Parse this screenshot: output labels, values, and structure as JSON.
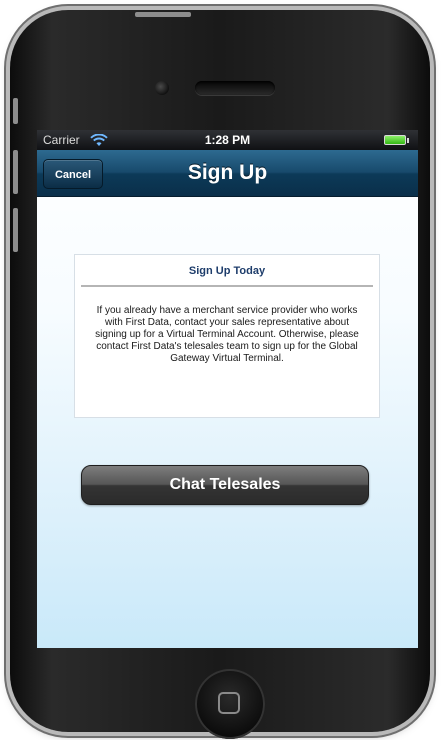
{
  "status_bar": {
    "carrier": "Carrier",
    "time": "1:28 PM",
    "wifi_icon": "wifi-icon",
    "battery_icon": "battery-icon",
    "battery_color": "#33b714"
  },
  "nav_bar": {
    "title": "Sign Up",
    "cancel_label": "Cancel",
    "color": "#184a6c"
  },
  "card": {
    "title": "Sign Up Today",
    "body": "If you already have a merchant service provider who works with First Data, contact your sales representative about signing up for a Virtual Terminal Account. Otherwise, please contact First Data's telesales team to sign up for the Global Gateway Virtual Terminal."
  },
  "actions": {
    "chat_label": "Chat Telesales"
  }
}
